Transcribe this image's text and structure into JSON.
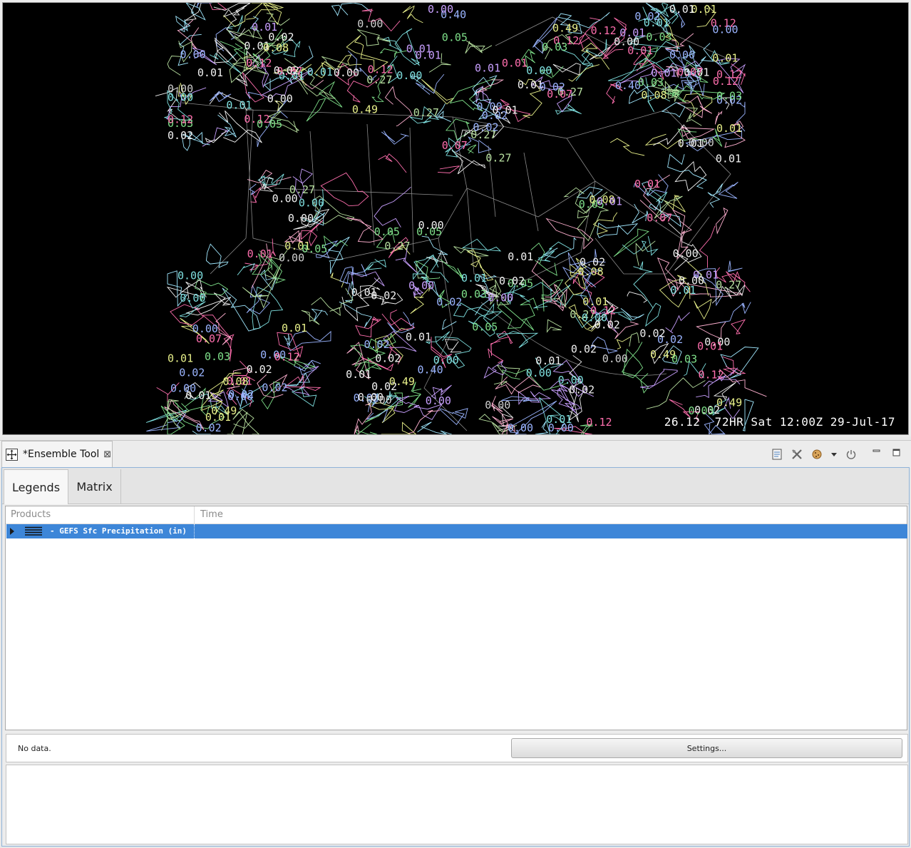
{
  "map": {
    "frame_label": "26.12  72HR Sat 12:00Z 29-Jul-17",
    "contour_values": [
      {
        "v": "0.00",
        "c": "#f2f2f2"
      },
      {
        "v": "0.01",
        "c": "#7fe0e0"
      },
      {
        "v": "0.00",
        "c": "#d0d0d0"
      },
      {
        "v": "0.01",
        "c": "#ff6fae"
      },
      {
        "v": "0.02",
        "c": "#9ab4ff"
      },
      {
        "v": "0.08",
        "c": "#e8f08a"
      },
      {
        "v": "0.03",
        "c": "#7fe08a"
      },
      {
        "v": "0.00",
        "c": "#c9a0ff"
      },
      {
        "v": "0.07",
        "c": "#ff6fae"
      },
      {
        "v": "0.00",
        "c": "#9ab4ff"
      },
      {
        "v": "0.01",
        "c": "#f2f2f2"
      },
      {
        "v": "0.49",
        "c": "#e8f08a"
      },
      {
        "v": "0.02",
        "c": "#f2f2f2"
      },
      {
        "v": "0.27",
        "c": "#b8e0a0"
      },
      {
        "v": "0.00",
        "c": "#7fe0e0"
      },
      {
        "v": "0.01",
        "c": "#c9a0ff"
      },
      {
        "v": "0.40",
        "c": "#9ab4ff"
      },
      {
        "v": "0.12",
        "c": "#ff6fae"
      },
      {
        "v": "0.05",
        "c": "#7fe08a"
      },
      {
        "v": "0.01",
        "c": "#e8f08a"
      }
    ]
  },
  "view": {
    "tab_title": "*Ensemble Tool",
    "close_glyph": "⊠",
    "toolbar_icons": [
      "notes-icon",
      "tools-icon",
      "cookie-icon",
      "dropdown-icon",
      "power-icon",
      "minimize-icon",
      "maximize-icon"
    ]
  },
  "panel": {
    "tabs": [
      {
        "label": "Legends"
      },
      {
        "label": "Matrix"
      }
    ],
    "columns": {
      "products": "Products",
      "time": "Time"
    },
    "rows": [
      {
        "label": "- GEFS Sfc Precipitation (in)",
        "time": ""
      }
    ],
    "status": "No data.",
    "settings_label": "Settings..."
  }
}
